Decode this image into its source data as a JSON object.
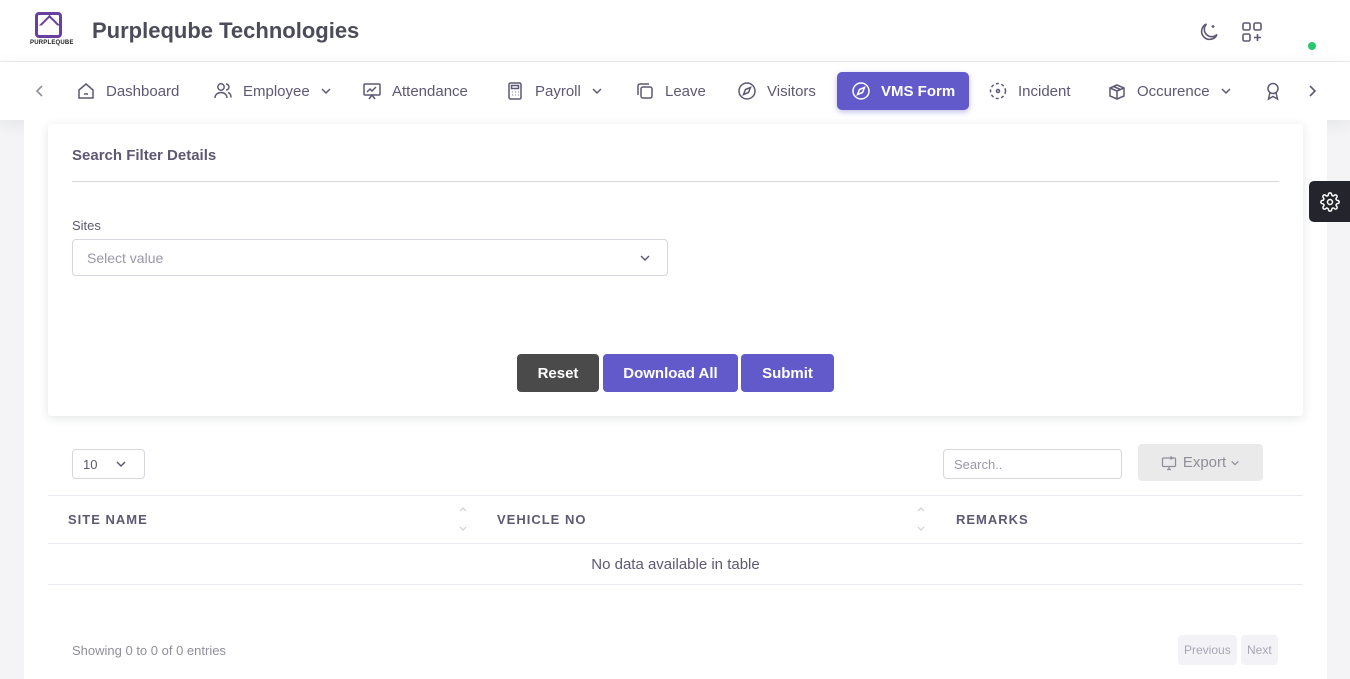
{
  "header": {
    "logo_text": "PURPLEQUBE",
    "brand": "Purpleqube Technologies",
    "icons": [
      "moon-icon",
      "apps-add-icon"
    ],
    "status_color": "#28c76f"
  },
  "nav": {
    "items": [
      {
        "label": "Dashboard",
        "icon": "home-icon"
      },
      {
        "label": "Employee",
        "icon": "users-icon",
        "dropdown": true
      },
      {
        "label": "Attendance",
        "icon": "presentation-chart-icon"
      },
      {
        "label": "Payroll",
        "icon": "calculator-icon",
        "dropdown": true
      },
      {
        "label": "Leave",
        "icon": "copy-icon"
      },
      {
        "label": "Visitors",
        "icon": "compass-icon"
      },
      {
        "label": "VMS Form",
        "icon": "compass-icon",
        "active": true
      },
      {
        "label": "Incident",
        "icon": "focus-icon"
      },
      {
        "label": "Occurence",
        "icon": "package-icon",
        "dropdown": true
      }
    ],
    "accent": "#6259ca"
  },
  "filter": {
    "title": "Search Filter Details",
    "sites_label": "Sites",
    "sites_placeholder": "Select value",
    "reset": "Reset",
    "download_all": "Download All",
    "submit": "Submit"
  },
  "table": {
    "page_length": "10",
    "search_placeholder": "Search..",
    "export": "Export",
    "columns": [
      "SITE NAME",
      "VEHICLE NO",
      "REMARKS"
    ],
    "empty": "No data available in table",
    "info": "Showing 0 to 0 of 0 entries",
    "prev": "Previous",
    "next": "Next"
  }
}
